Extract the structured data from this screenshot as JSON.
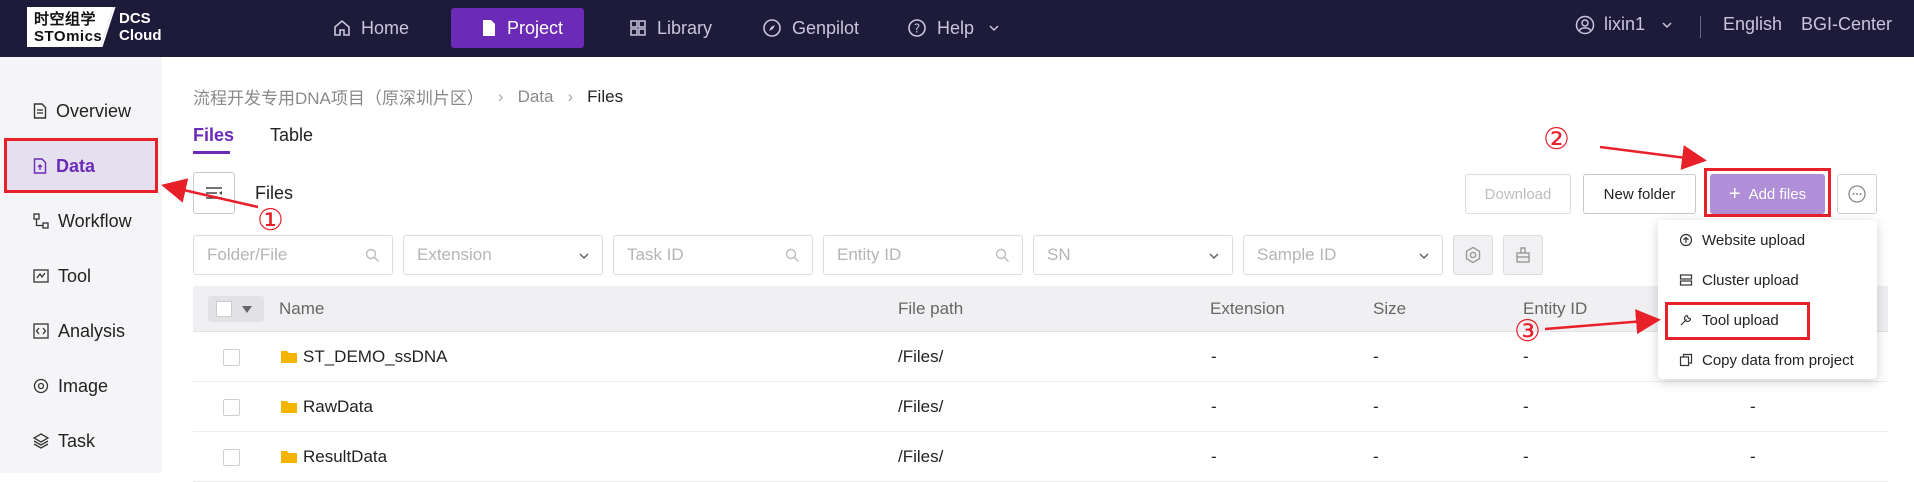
{
  "app": {
    "logo_line1": "时空组学",
    "logo_line2": "STOmics",
    "brand_line1": "DCS",
    "brand_line2": "Cloud"
  },
  "topnav": {
    "items": [
      {
        "label": "Home",
        "icon": "home-icon"
      },
      {
        "label": "Project",
        "icon": "file-icon",
        "active": true
      },
      {
        "label": "Library",
        "icon": "grid-icon"
      },
      {
        "label": "Genpilot",
        "icon": "compass-icon"
      },
      {
        "label": "Help",
        "icon": "question-icon"
      }
    ],
    "user": "lixin1",
    "language": "English",
    "center": "BGI-Center"
  },
  "sidebar": {
    "items": [
      {
        "label": "Overview",
        "icon": "document-icon"
      },
      {
        "label": "Data",
        "icon": "data-file-icon",
        "active": true
      },
      {
        "label": "Workflow",
        "icon": "workflow-icon"
      },
      {
        "label": "Tool",
        "icon": "tool-icon"
      },
      {
        "label": "Analysis",
        "icon": "code-icon"
      },
      {
        "label": "Image",
        "icon": "image-icon"
      },
      {
        "label": "Task",
        "icon": "layers-icon"
      }
    ]
  },
  "breadcrumb": {
    "project": "流程开发专用DNA项目（原深圳片区）",
    "level2": "Data",
    "current": "Files"
  },
  "tabs": [
    "Files",
    "Table"
  ],
  "toolbar": {
    "files_label": "Files",
    "download": "Download",
    "new_folder": "New folder",
    "add_files": "Add files"
  },
  "filters": {
    "folder_file": "Folder/File",
    "extension": "Extension",
    "task_id": "Task ID",
    "entity_id": "Entity ID",
    "sn": "SN",
    "sample_id": "Sample ID"
  },
  "table": {
    "columns": [
      "Name",
      "File path",
      "Extension",
      "Size",
      "Entity ID"
    ],
    "rows": [
      {
        "name": "ST_DEMO_ssDNA",
        "path": "/Files/",
        "extension": "-",
        "size": "-",
        "entity": "-",
        "last": ""
      },
      {
        "name": "RawData",
        "path": "/Files/",
        "extension": "-",
        "size": "-",
        "entity": "-",
        "last": "-"
      },
      {
        "name": "ResultData",
        "path": "/Files/",
        "extension": "-",
        "size": "-",
        "entity": "-",
        "last": "-"
      }
    ]
  },
  "add_menu": {
    "items": [
      {
        "label": "Website upload",
        "icon": "upload-icon"
      },
      {
        "label": "Cluster upload",
        "icon": "server-icon"
      },
      {
        "label": "Tool upload",
        "icon": "wrench-icon"
      },
      {
        "label": "Copy data from project",
        "icon": "copy-icon"
      }
    ]
  },
  "annotations": {
    "one": "①",
    "two": "②",
    "three": "③"
  },
  "colors": {
    "accent": "#6c2bb6",
    "topbar": "#1d1a3a",
    "highlight": "#e8202a",
    "folder": "#f5b400"
  }
}
